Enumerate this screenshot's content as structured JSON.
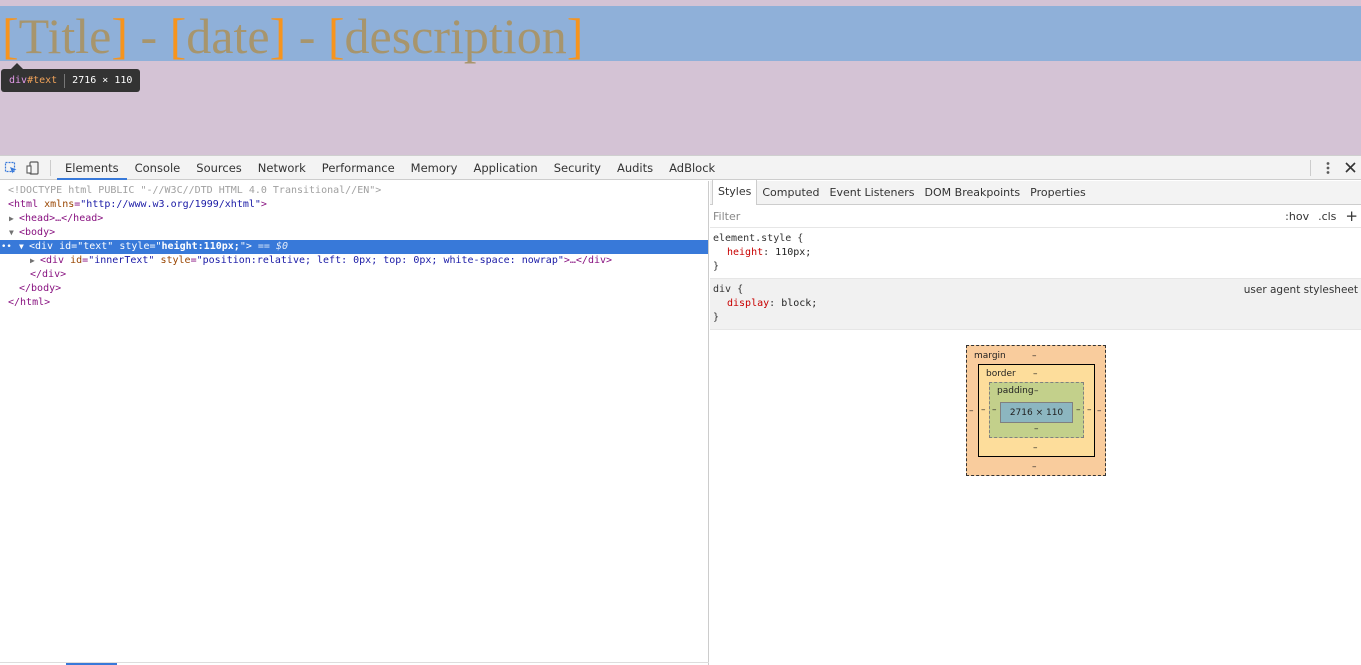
{
  "page": {
    "text_parts": [
      "[",
      "Title",
      "] - ",
      "[",
      "date",
      "] - ",
      "[",
      "description",
      "]"
    ]
  },
  "tooltip": {
    "tag": "div",
    "id": "#text",
    "size": "2716 × 110"
  },
  "toolbar": {
    "tabs": [
      "Elements",
      "Console",
      "Sources",
      "Network",
      "Performance",
      "Memory",
      "Application",
      "Security",
      "Audits",
      "AdBlock"
    ],
    "active_tab": "Elements",
    "inspect_icon": "inspect-element-icon",
    "device_icon": "device-toolbar-icon",
    "more_icon": "kebab-menu-icon",
    "close_icon": "close-icon"
  },
  "dom": {
    "doctype": "<!DOCTYPE html PUBLIC \"-//W3C//DTD HTML 4.0 Transitional//EN\">",
    "html_open_tag": "<html",
    "html_attr": "xmlns",
    "html_val": "\"http://www.w3.org/1999/xhtml\"",
    "head": "<head>…</head>",
    "body_open": "<body>",
    "div_tag": "<div",
    "div_id_attr": "id",
    "div_id_val": "\"text\"",
    "div_style_attr": "style",
    "div_style_val_pre": "\"",
    "div_style_val_bold": "height:110px;",
    "div_style_val_post": "\">",
    "selected_marker": "== $0",
    "inner_tag": "<div",
    "inner_id_attr": "id",
    "inner_id_val": "\"innerText\"",
    "inner_style_attr": "style",
    "inner_style_val": "\"position:relative; left: 0px; top: 0px; white-space: nowrap\"",
    "inner_close": ">…</div>",
    "div_close": "</div>",
    "body_close": "</body>",
    "html_close": "</html>"
  },
  "sidebar": {
    "tabs": [
      "Styles",
      "Computed",
      "Event Listeners",
      "DOM Breakpoints",
      "Properties"
    ],
    "active_tab": "Styles",
    "filter_placeholder": "Filter",
    "hov": ":hov",
    "cls": ".cls",
    "plus": "+",
    "rules": [
      {
        "selector": "element.style {",
        "source": "",
        "props": [
          {
            "name": "height",
            "value": "110px;"
          }
        ],
        "close": "}"
      },
      {
        "selector": "div {",
        "source": "user agent stylesheet",
        "props": [
          {
            "name": "display",
            "value": "block;"
          }
        ],
        "close": "}"
      }
    ]
  },
  "box_model": {
    "margin_label": "margin",
    "border_label": "border",
    "padding_label": "padding",
    "dash": "–",
    "content": "2716 × 110"
  },
  "colors": {
    "preview_bg": "#d4c3d5",
    "highlight": "#8fb0d9",
    "text_color": "#a7956d",
    "bracket_color": "#f7941d",
    "selection": "#3879d9"
  }
}
